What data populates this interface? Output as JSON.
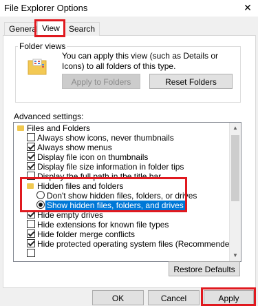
{
  "window": {
    "title": "File Explorer Options",
    "close_glyph": "✕"
  },
  "tabs": [
    {
      "label": "General",
      "active": false
    },
    {
      "label": "View",
      "active": true
    },
    {
      "label": "Search",
      "active": false
    }
  ],
  "folder_views": {
    "label": "Folder views",
    "description": "You can apply this view (such as Details or Icons) to all folders of this type.",
    "apply_button": "Apply to Folders",
    "reset_button": "Reset Folders"
  },
  "advanced": {
    "label": "Advanced settings:",
    "items": [
      {
        "type": "folder",
        "level": 0,
        "label": "Files and Folders",
        "icon": "folder-icon"
      },
      {
        "type": "checkbox",
        "level": 1,
        "label": "Always show icons, never thumbnails",
        "checked": false
      },
      {
        "type": "checkbox",
        "level": 1,
        "label": "Always show menus",
        "checked": true
      },
      {
        "type": "checkbox",
        "level": 1,
        "label": "Display file icon on thumbnails",
        "checked": true
      },
      {
        "type": "checkbox",
        "level": 1,
        "label": "Display file size information in folder tips",
        "checked": true
      },
      {
        "type": "checkbox",
        "level": 1,
        "label": "Display the full path in the title bar",
        "checked": false
      },
      {
        "type": "folder",
        "level": 1,
        "label": "Hidden files and folders",
        "icon": "folder-icon"
      },
      {
        "type": "radio",
        "level": 2,
        "label": "Don't show hidden files, folders, or drives",
        "checked": false
      },
      {
        "type": "radio",
        "level": 2,
        "label": "Show hidden files, folders, and drives",
        "checked": true,
        "selected": true
      },
      {
        "type": "checkbox",
        "level": 1,
        "label": "Hide empty drives",
        "checked": true
      },
      {
        "type": "checkbox",
        "level": 1,
        "label": "Hide extensions for known file types",
        "checked": false
      },
      {
        "type": "checkbox",
        "level": 1,
        "label": "Hide folder merge conflicts",
        "checked": true
      },
      {
        "type": "checkbox",
        "level": 1,
        "label": "Hide protected operating system files (Recommended)",
        "checked": true
      },
      {
        "type": "checkbox",
        "level": 1,
        "label": "",
        "checked": false
      }
    ]
  },
  "restore_defaults": "Restore Defaults",
  "footer": {
    "ok": "OK",
    "cancel": "Cancel",
    "apply": "Apply"
  },
  "highlight_color": "#e0191f",
  "selection_color": "#0078d7"
}
